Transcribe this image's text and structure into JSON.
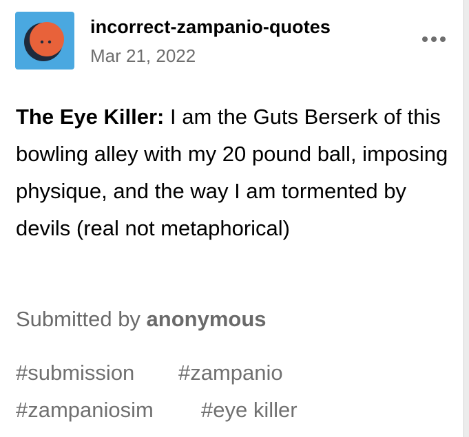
{
  "post": {
    "blog_name": "incorrect-zampanio-quotes",
    "date": "Mar 21, 2022",
    "speaker": "The Eye Killer:",
    "quote": " I am the Guts Berserk of this bowling alley with my 20 pound ball, imposing physique, and the way I am tormented by devils (real not metaphorical)",
    "submitted_prefix": "Submitted by ",
    "submitter": "anonymous",
    "tags": [
      "#submission",
      "#zampanio",
      "#zampaniosim",
      "#eye killer"
    ]
  },
  "icons": {
    "avatar": "orange-blob-face-avatar",
    "more": "more-horizontal-icon"
  },
  "colors": {
    "avatar_background": "#4aa8e0",
    "avatar_blob": "#e8623a",
    "meta_text": "#6e6e6e",
    "tag_text": "#707070"
  }
}
